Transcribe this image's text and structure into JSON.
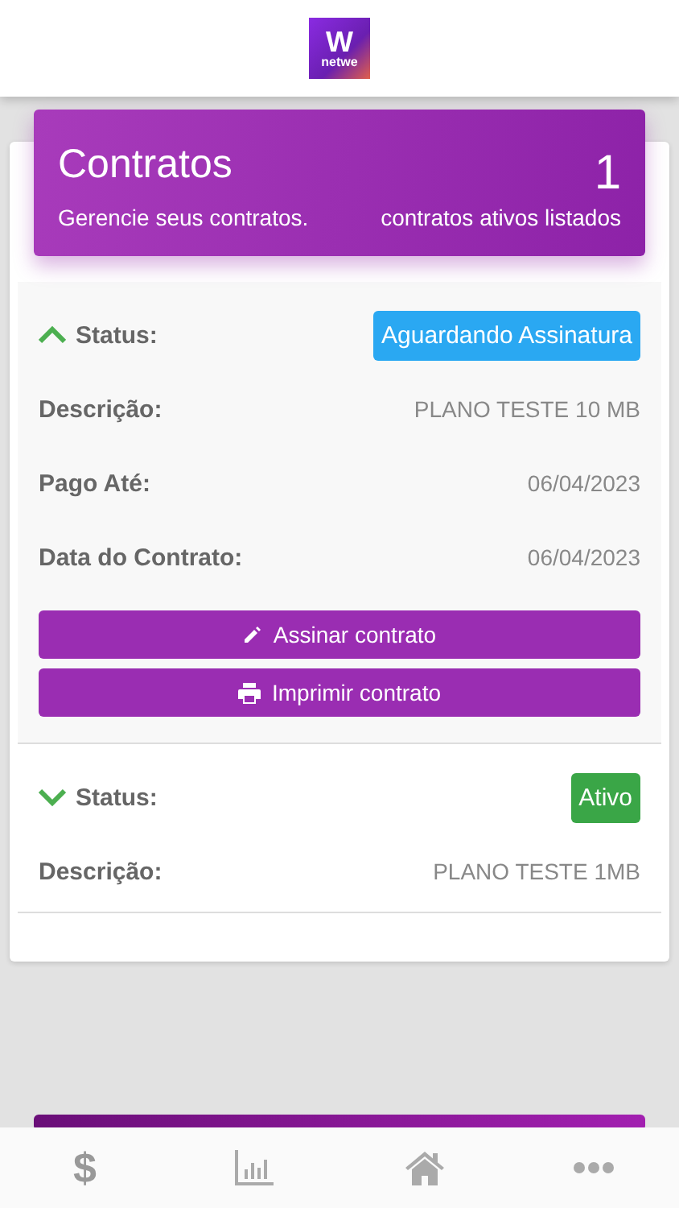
{
  "logo": {
    "letter": "W",
    "wordmark": "netwe"
  },
  "summary": {
    "title": "Contratos",
    "subtitle": "Gerencie seus contratos.",
    "count": "1",
    "count_label": "contratos ativos listados"
  },
  "contracts": [
    {
      "expanded": true,
      "status_label": "Status:",
      "status": "Aguardando Assinatura",
      "color": "#2aa8f2",
      "fields": [
        {
          "label": "Descrição:",
          "value": "PLANO TESTE 10 MB"
        },
        {
          "label": "Pago Até:",
          "value": "06/04/2023"
        },
        {
          "label": "Data do Contrato:",
          "value": "06/04/2023"
        }
      ],
      "actions": [
        {
          "kind": "sign",
          "label": "Assinar contrato"
        },
        {
          "kind": "print",
          "label": "Imprimir contrato"
        }
      ]
    },
    {
      "expanded": false,
      "status_label": "Status:",
      "status": "Ativo",
      "color": "#3aa647",
      "fields": [
        {
          "label": "Descrição:",
          "value": "PLANO TESTE 1MB"
        }
      ]
    }
  ],
  "bottom_nav": [
    {
      "kind": "money",
      "glyph": "$"
    },
    {
      "kind": "chart"
    },
    {
      "kind": "home"
    },
    {
      "kind": "more"
    }
  ]
}
